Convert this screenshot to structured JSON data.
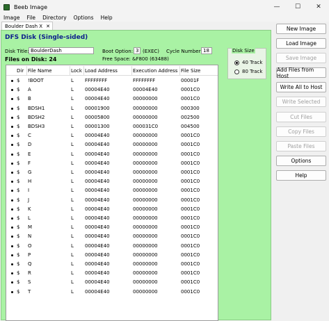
{
  "window": {
    "title": "Beeb Image",
    "minimize_glyph": "—",
    "maximize_glyph": "☐",
    "close_glyph": "✕"
  },
  "menu": [
    "Image",
    "File",
    "Directory",
    "Options",
    "Help"
  ],
  "tab": {
    "label": "Boulder Dash X",
    "close_glyph": "✕"
  },
  "disk": {
    "heading": "DFS Disk (Single-sided)",
    "title_label": "Disk Title:",
    "title_value": "BoulderDash",
    "boot_label": "Boot Option:",
    "boot_value": "3",
    "boot_desc": "(EXEC)",
    "cycle_label": "Cycle Number:",
    "cycle_value": "18",
    "free_space": "Free Space: &F800 (63488)",
    "files_on_disk": "Files on Disk: 24",
    "size": {
      "legend": "Disk Size",
      "option40": "40 Track",
      "option80": "80 Track",
      "selected": "40 Track"
    }
  },
  "table": {
    "columns": [
      "Dir",
      "File Name",
      "Lock",
      "Load Address",
      "Execution Address",
      "File Size"
    ],
    "rows": [
      [
        "$",
        "!BOOT",
        "L",
        "FFFFFFFF",
        "FFFFFFFF",
        "00001F"
      ],
      [
        "$",
        "A",
        "L",
        "00004E40",
        "00004E40",
        "0001C0"
      ],
      [
        "$",
        "B",
        "L",
        "00004E40",
        "00000000",
        "0001C0"
      ],
      [
        "$",
        "BDSH1",
        "L",
        "00001900",
        "00000000",
        "000300"
      ],
      [
        "$",
        "BDSH2",
        "L",
        "00005800",
        "00000000",
        "002500"
      ],
      [
        "$",
        "BDSH3",
        "L",
        "00001300",
        "000031C0",
        "004500"
      ],
      [
        "$",
        "C",
        "L",
        "00004E40",
        "00000000",
        "0001C0"
      ],
      [
        "$",
        "D",
        "L",
        "00004E40",
        "00000000",
        "0001C0"
      ],
      [
        "$",
        "E",
        "L",
        "00004E40",
        "00000000",
        "0001C0"
      ],
      [
        "$",
        "F",
        "L",
        "00004E40",
        "00000000",
        "0001C0"
      ],
      [
        "$",
        "G",
        "L",
        "00004E40",
        "00000000",
        "0001C0"
      ],
      [
        "$",
        "H",
        "L",
        "00004E40",
        "00000000",
        "0001C0"
      ],
      [
        "$",
        "I",
        "L",
        "00004E40",
        "00000000",
        "0001C0"
      ],
      [
        "$",
        "J",
        "L",
        "00004E40",
        "00000000",
        "0001C0"
      ],
      [
        "$",
        "K",
        "L",
        "00004E40",
        "00000000",
        "0001C0"
      ],
      [
        "$",
        "L",
        "L",
        "00004E40",
        "00000000",
        "0001C0"
      ],
      [
        "$",
        "M",
        "L",
        "00004E40",
        "00000000",
        "0001C0"
      ],
      [
        "$",
        "N",
        "L",
        "00004E40",
        "00000000",
        "0001C0"
      ],
      [
        "$",
        "O",
        "L",
        "00004E40",
        "00000000",
        "0001C0"
      ],
      [
        "$",
        "P",
        "L",
        "00004E40",
        "00000000",
        "0001C0"
      ],
      [
        "$",
        "Q",
        "L",
        "00004E40",
        "00000000",
        "0001C0"
      ],
      [
        "$",
        "R",
        "L",
        "00004E40",
        "00000000",
        "0001C0"
      ],
      [
        "$",
        "S",
        "L",
        "00004E40",
        "00000000",
        "0001C0"
      ],
      [
        "$",
        "T",
        "L",
        "00004E40",
        "00000000",
        "0001C0"
      ]
    ]
  },
  "buttons": [
    {
      "label": "New Image",
      "enabled": true
    },
    {
      "label": "Load Image",
      "enabled": true
    },
    {
      "label": "Save Image",
      "enabled": false
    },
    {
      "label": "Add Files from Host",
      "enabled": true
    },
    {
      "label": "Write All to Host",
      "enabled": true
    },
    {
      "label": "Write Selected",
      "enabled": false
    },
    {
      "label": "Cut Files",
      "enabled": false
    },
    {
      "label": "Copy Files",
      "enabled": false
    },
    {
      "label": "Paste Files",
      "enabled": false
    },
    {
      "label": "Options",
      "enabled": true
    },
    {
      "label": "Help",
      "enabled": true
    }
  ],
  "colors": {
    "panel_bg": "#a9f2a4",
    "heading": "#0c1e8c"
  }
}
